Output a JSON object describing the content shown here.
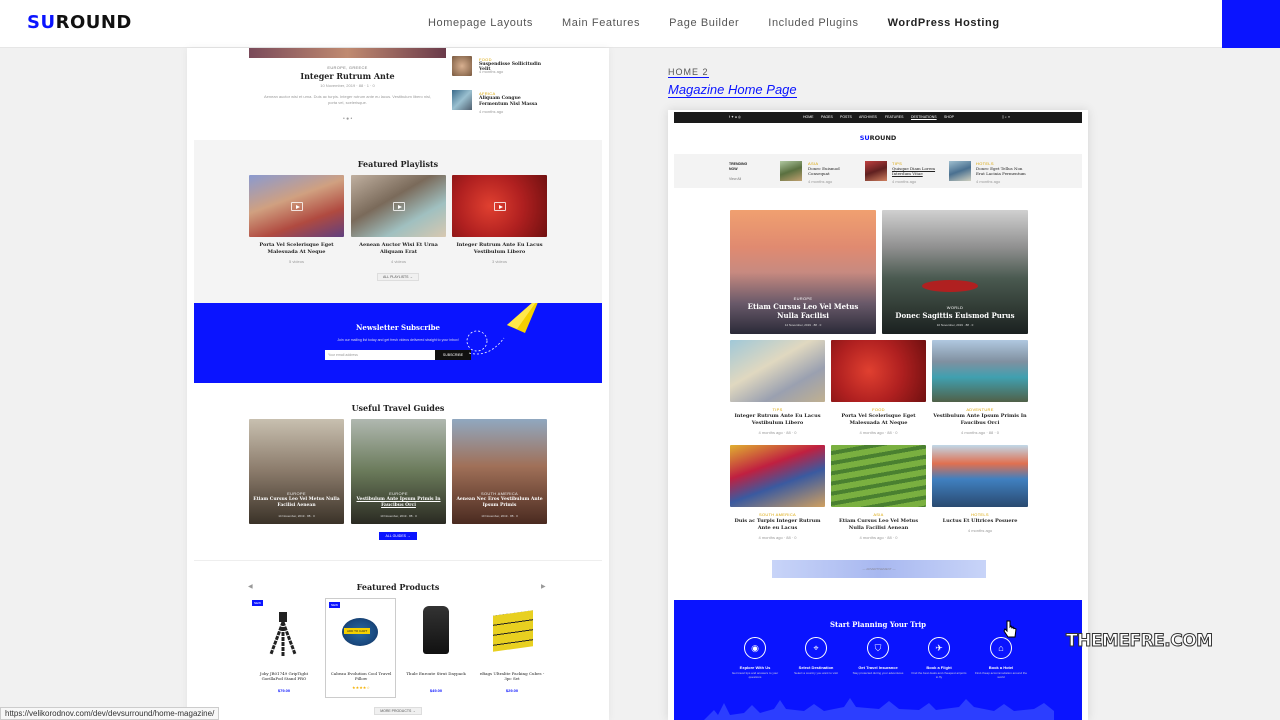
{
  "header": {
    "logo_mark": "SU",
    "logo_text": "ROUND",
    "nav": [
      "Homepage Layouts",
      "Main Features",
      "Page Builder",
      "Included Plugins",
      "WordPress Hosting"
    ]
  },
  "left_page": {
    "top_post": {
      "category": "EUROPE, GREECE",
      "title": "Integer Rutrum Ante",
      "meta": "10 November, 2019  ·  88  ·  1  ·  0",
      "excerpt": "Aenean auctor wisi et urna. Duis ac turpis. Integer rutrum ante eu lacus. Vestibulum libero nisl, porta vel, scelerisque."
    },
    "side_posts": [
      {
        "category": "FOOD",
        "title": "Suspendisse Sollicitudin Velit",
        "time": "4 months ago"
      },
      {
        "category": "AFRICA",
        "title": "Aliquam Congue Fermentum Nisl Massa",
        "time": "4 months ago"
      }
    ],
    "featured_playlists": {
      "title": "Featured Playlists",
      "items": [
        {
          "title": "Porta Vel Scelerisque Eget Malesuada At Neque",
          "meta": "5 videos"
        },
        {
          "title": "Aenean Auctor Wisi Et Urna Aliquam Erat",
          "meta": "4 videos"
        },
        {
          "title": "Integer Rutrum Ante Eu Lacus Vestibulum Libero",
          "meta": "3 videos"
        }
      ],
      "button": "ALL PLAYLISTS  →"
    },
    "newsletter": {
      "title": "Newsletter Subscribe",
      "text": "Join our mailing list today and get fresh videos delivered straight to your inbox!",
      "placeholder": "Your email address",
      "button": "SUBSCRIBE"
    },
    "travel_guides": {
      "title": "Useful Travel Guides",
      "items": [
        {
          "category": "EUROPE",
          "title": "Etiam Cursus Leo Vel Metus Nulla Facilisi Aenean",
          "meta": "14 November, 2019  ·  88  ·  0"
        },
        {
          "category": "EUROPE",
          "title": "Vestibulum Ante Ipsum Primis In Faucibus Orci",
          "meta": "10 November, 2019  ·  88  ·  0"
        },
        {
          "category": "SOUTH AMERICA",
          "title": "Aenean Nec Eros Vestibulum Ante Ipsum Primis",
          "meta": "10 November, 2019  ·  88  ·  0"
        }
      ],
      "button": "ALL GUIDES  →"
    },
    "featured_products": {
      "title": "Featured Products",
      "items": [
        {
          "badge": "NEW",
          "title": "Joby JB01749 GripTight GorillaPod Stand PRO",
          "price": "$79.00"
        },
        {
          "badge": "NEW",
          "title": "Cabeau Evolution Cool Travel Pillow",
          "price": "",
          "add_to_cart": "ADD TO CART",
          "rating": "★★★★☆"
        },
        {
          "badge": "",
          "title": "Thule Enroute Strut Daypack",
          "price": "$49.00"
        },
        {
          "badge": "",
          "title": "eBags Ultralite Packing Cubes - 3pc Set",
          "price": "$29.00"
        }
      ],
      "button": "MORE PRODUCTS  →"
    }
  },
  "home2": {
    "label": "HOME 2",
    "title": "Magazine Home Page"
  },
  "preview": {
    "nav": [
      "HOME",
      "PAGES",
      "POSTS",
      "ARCHIVES",
      "FEATURES",
      "DESTINATIONS",
      "SHOP"
    ],
    "logo_mark": "SU",
    "logo_text": "ROUND",
    "trending": {
      "label": "TRENDING NOW",
      "view": "View All",
      "items": [
        {
          "category": "ASIA",
          "title": "Donec Euismod Consequat",
          "time": "4 months ago"
        },
        {
          "category": "TIPS",
          "title": "Quisque Diam Lorem Interdum Vitae",
          "time": "4 months ago"
        },
        {
          "category": "HOTELS",
          "title": "Donec Eget Tellus Non Erat Lacinia Fermentum",
          "time": "4 months ago"
        }
      ]
    },
    "big_posts": [
      {
        "category": "EUROPE",
        "title": "Etiam Cursus Leo Vel Metus Nulla Facilisi",
        "meta": "14 November, 2019  ·  88  ·  0"
      },
      {
        "category": "WORLD",
        "title": "Donec Sagittis Euismod Purus",
        "meta": "10 November, 2019  ·  88  ·  0"
      }
    ],
    "grid_posts": [
      {
        "category": "TIPS",
        "title": "Integer Rutrum Ante Eu Lacus Vestibulum Libero",
        "meta": "4 months ago  ·  88  ·  0"
      },
      {
        "category": "FOOD",
        "title": "Porta Vel Scelerisque Eget Malesuada At Neque",
        "meta": "4 months ago  ·  88  ·  0"
      },
      {
        "category": "ADVENTURE",
        "title": "Vestibulum Ante Ipsum Primis In Faucibus Orci",
        "meta": "4 months ago  ·  88  ·  0"
      },
      {
        "category": "SOUTH AMERICA",
        "title": "Duis ac Turpis Integer Rutrum Ante eu Lacus",
        "meta": "4 months ago  ·  88  ·  0"
      },
      {
        "category": "ASIA",
        "title": "Etiam Cursus Leo Vel Metus Nulla Facilisi Aenean",
        "meta": "4 months ago  ·  88  ·  0"
      },
      {
        "category": "HOTELS",
        "title": "Luctus Et Ultrices Posuere",
        "meta": "4 months ago"
      }
    ],
    "ad_label": "— ADVERTISEMENT —",
    "planning": {
      "title": "Start Planning Your Trip",
      "steps": [
        {
          "title": "Explore With Us",
          "text": "Get travel tips and answers to your questions"
        },
        {
          "title": "Select Destination",
          "text": "Select a country you want to visit"
        },
        {
          "title": "Get Travel Insurance",
          "text": "Stay protected during your adventures"
        },
        {
          "title": "Book a Flight",
          "text": "Find the best deals and cheapest airports to fly"
        },
        {
          "title": "Book a Hotel",
          "text": "Find cheap accommodation around the world"
        }
      ]
    }
  },
  "watermark": "THEMEFRE.COM",
  "status_url": "https://velikorodnov.com/dev/devsurround/home-magazine/",
  "colors": {
    "accent": "#0a14ff"
  }
}
